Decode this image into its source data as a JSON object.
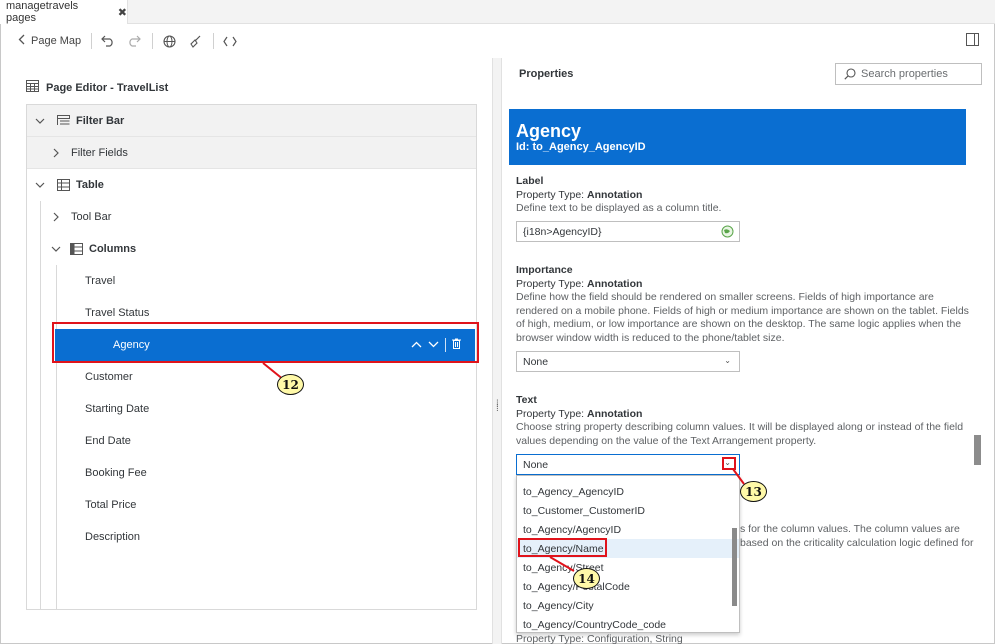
{
  "tab": {
    "title": "managetravels pages",
    "close": "✖"
  },
  "toolbar": {
    "page_map_label": "Page Map"
  },
  "editor": {
    "title": "Page Editor - TravelList"
  },
  "tree": {
    "filter_bar": "Filter Bar",
    "filter_fields": "Filter Fields",
    "table": "Table",
    "tool_bar": "Tool Bar",
    "columns": "Columns",
    "items": [
      "Travel",
      "Travel Status",
      "Agency",
      "Customer",
      "Starting Date",
      "End Date",
      "Booking Fee",
      "Total Price",
      "Description"
    ]
  },
  "properties": {
    "title": "Properties",
    "search_placeholder": "Search properties",
    "header_title": "Agency",
    "header_id": "Id: to_Agency_AgencyID",
    "label": {
      "name": "Label",
      "ptype_prefix": "Property Type: ",
      "ptype": "Annotation",
      "desc": "Define text to be displayed as a column title.",
      "value": "{i18n>AgencyID}"
    },
    "importance": {
      "name": "Importance",
      "ptype_prefix": "Property Type: ",
      "ptype": "Annotation",
      "desc": "Define how the field should be rendered on smaller screens. Fields of high importance are rendered on a mobile phone. Fields of high or medium importance are shown on the tablet. Fields of high, medium, or low importance are shown on the desktop. The same logic applies when the browser window width is reduced to the phone/tablet size.",
      "value": "None"
    },
    "text": {
      "name": "Text",
      "ptype_prefix": "Property Type: ",
      "ptype": "Annotation",
      "desc": "Choose string property describing column values. It will be displayed along or instead of the field values depending on the value of the Text Arrangement property.",
      "value": "None"
    },
    "dropdown_options": [
      "to_Agency_AgencyID",
      "to_Customer_CustomerID",
      "to_Agency/AgencyID",
      "to_Agency/Name",
      "to_Agency/Street",
      "to_Agency/PostalCode",
      "to_Agency/City",
      "to_Agency/CountryCode_code"
    ],
    "hidden_text_1": "s for the column values. The column values are",
    "hidden_text_2": "based on the criticality calculation logic defined for",
    "hidden_text_3": "Property Type: Configuration, String"
  },
  "callouts": {
    "c12": "12",
    "c13": "13",
    "c14": "14"
  },
  "colors": {
    "accent": "#0a6ed1",
    "highlight_red": "#e0131b",
    "callout_fill": "#fff9a8"
  }
}
